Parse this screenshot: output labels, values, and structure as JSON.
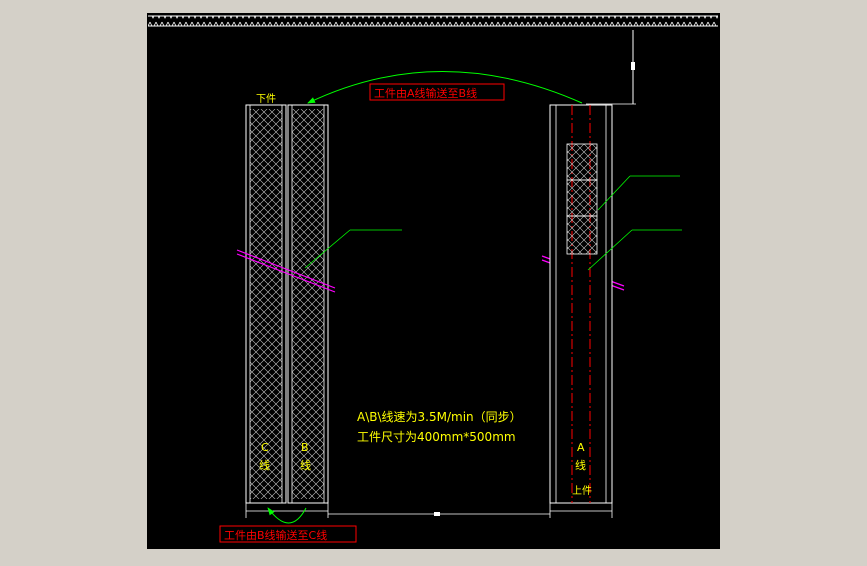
{
  "colors": {
    "background": "#000000",
    "border": "#ffffff",
    "annotation_red": "#ff0000",
    "leader_green": "#00ff00",
    "text_yellow": "#ffff00",
    "section_magenta": "#ff00ff",
    "centerline_red": "#ff0000"
  },
  "labels": {
    "top_transfer": "工件由A线输送至B线",
    "bottom_transfer": "工件由B线输送至C线",
    "unload": "下件",
    "load": "上件",
    "line_c": "C",
    "line_b": "B",
    "line_a": "A",
    "line_char": "线",
    "speed": "A\\B\\线速为3.5M/min（同步）",
    "size": "工件尺寸为400mm*500mm"
  }
}
